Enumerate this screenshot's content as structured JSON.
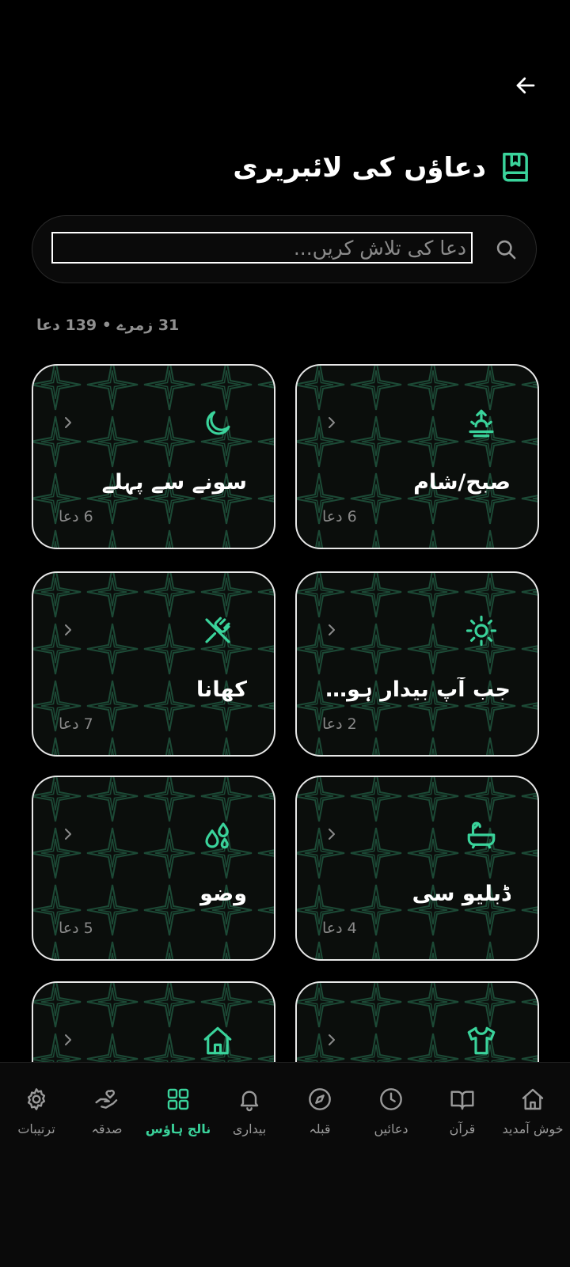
{
  "header": {
    "title": "دعاؤں کی لائبریری",
    "back_icon": "arrow-left-icon",
    "title_icon": "book-bookmark-icon"
  },
  "search": {
    "placeholder": "دعا کی تلاش کریں...",
    "value": ""
  },
  "stats": "31 زمرے • 139 دعا",
  "colors": {
    "accent": "#3ad39b",
    "background": "#000000",
    "card_border": "#e8e8e8",
    "pattern": "#1c4a36",
    "muted_text": "#8a8a8a"
  },
  "categories": [
    {
      "title": "صبح/شام",
      "count": "6 دعا",
      "icon": "sunrise-icon"
    },
    {
      "title": "سونے سے پہلے",
      "count": "6 دعا",
      "icon": "moon-icon"
    },
    {
      "title": "جب آپ بیدار ہوتے ہ...",
      "count": "2 دعا",
      "icon": "sun-icon"
    },
    {
      "title": "کھانا",
      "count": "7 دعا",
      "icon": "fork-knife-icon"
    },
    {
      "title": "ڈبلیو سی",
      "count": "4 دعا",
      "icon": "bathtub-icon"
    },
    {
      "title": "وضو",
      "count": "5 دعا",
      "icon": "water-drops-icon"
    },
    {
      "title": "",
      "count": "",
      "icon": "tshirt-icon"
    },
    {
      "title": "",
      "count": "",
      "icon": "home-icon"
    }
  ],
  "nav": {
    "items": [
      {
        "label": "خوش آمدید",
        "icon": "home-icon",
        "active": false
      },
      {
        "label": "قرآن",
        "icon": "open-book-icon",
        "active": false
      },
      {
        "label": "دعائیں",
        "icon": "clock-icon",
        "active": false
      },
      {
        "label": "قبلہ",
        "icon": "compass-icon",
        "active": false
      },
      {
        "label": "بیداری",
        "icon": "bell-icon",
        "active": false
      },
      {
        "label": "نالج ہاؤس",
        "icon": "grid-icon",
        "active": true
      },
      {
        "label": "صدقہ",
        "icon": "hand-heart-icon",
        "active": false
      },
      {
        "label": "ترتیبات",
        "icon": "gear-icon",
        "active": false
      }
    ]
  }
}
